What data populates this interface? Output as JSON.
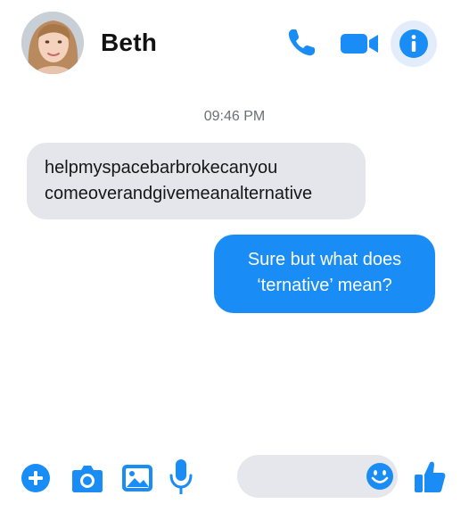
{
  "header": {
    "contact_name": "Beth",
    "icons": [
      "avatar",
      "phone-icon",
      "video-camera-icon",
      "info-icon"
    ]
  },
  "conversation": {
    "timestamp": "09:46 PM",
    "messages": [
      {
        "direction": "incoming",
        "text": "helpmyspacebarbrokecanyou\ncomeoverandgivemeanalternative"
      },
      {
        "direction": "outgoing",
        "text": "Sure but what does\n‘ternative’ mean?"
      }
    ]
  },
  "composer": {
    "input_value": "",
    "icons": [
      "plus-icon",
      "camera-icon",
      "image-icon",
      "microphone-icon",
      "emoji-icon",
      "thumbs-up-icon"
    ]
  },
  "colors": {
    "accent": "#1a8cf5",
    "incoming_bubble": "#e5e6eb",
    "input_background": "#e6e7ec"
  }
}
